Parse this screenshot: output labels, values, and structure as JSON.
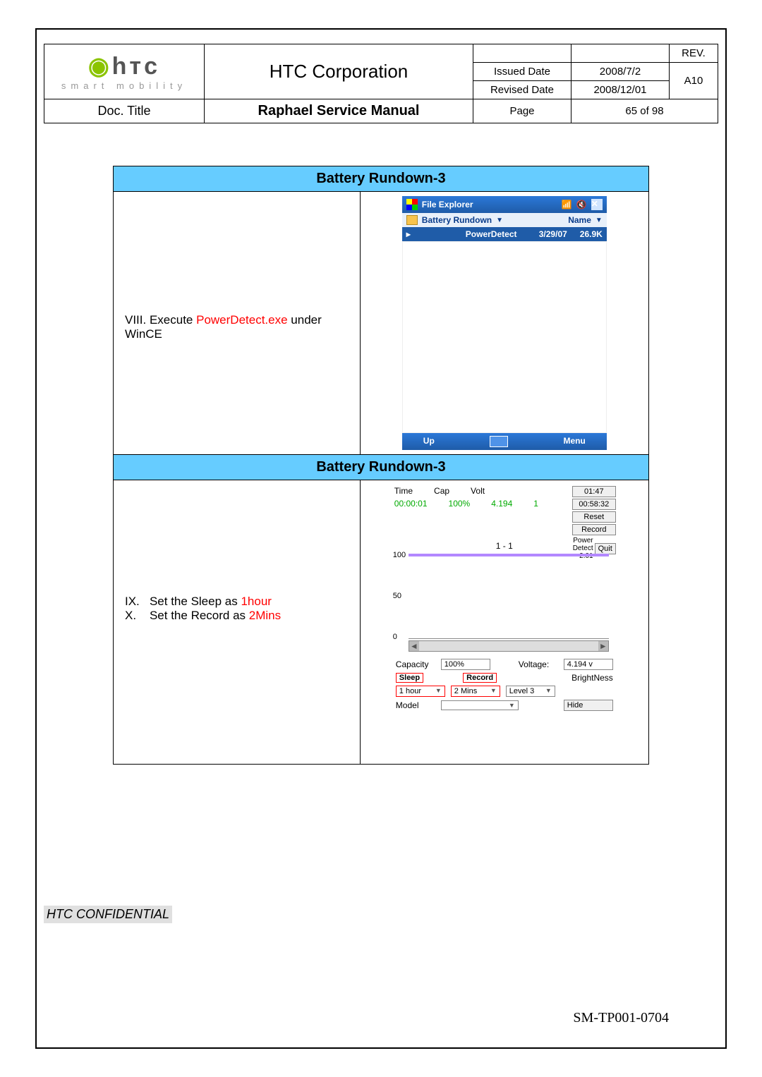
{
  "header": {
    "corp": "HTC Corporation",
    "tagline": "smart mobility",
    "rev_label": "REV.",
    "rev_value": "A10",
    "issued_label": "Issued Date",
    "issued_value": "2008/7/2",
    "revised_label": "Revised Date",
    "revised_value": "2008/12/01",
    "doc_label": "Doc. Title",
    "doc_title": "Raphael Service Manual",
    "page_label": "Page",
    "page_value": "65 of 98"
  },
  "section1": {
    "title": "Battery Rundown-3",
    "instr_num": "VIII.",
    "instr_pre": " Execute ",
    "instr_red": "PowerDetect.exe",
    "instr_post": " under WinCE",
    "fe": {
      "title": "File Explorer",
      "location": "Battery Rundown",
      "sort": "Name",
      "file": "PowerDetect",
      "date": "3/29/07",
      "size": "26.9K",
      "up": "Up",
      "menu": "Menu"
    }
  },
  "section2": {
    "title": "Battery Rundown-3",
    "ix": {
      "num": "IX.",
      "pre": "Set the Sleep as ",
      "red": "1hour"
    },
    "x": {
      "num": "X.",
      "pre": "Set the Record as ",
      "red": "2Mins"
    },
    "pd": {
      "cols": {
        "time": "Time",
        "cap": "Cap",
        "volt": "Volt"
      },
      "vals": {
        "time": "00:00:01",
        "cap": "100%",
        "volt": "4.194",
        "n": "1"
      },
      "side": [
        "01:47",
        "00:58:32",
        "Reset",
        "Record",
        "Quit"
      ],
      "ver": "Power Detect 2.01",
      "gtitle": "1 - 1",
      "y100": "100",
      "y50": "50",
      "y0": "0",
      "cap_label": "Capacity",
      "cap_val": "100%",
      "volt_label": "Voltage:",
      "volt_val": "4.194 v",
      "sleep": "Sleep",
      "sleep_v": "1 hour",
      "record": "Record",
      "record_v": "2 Mins",
      "bright": "BrightNess",
      "bright_v": "Level 3",
      "model": "Model",
      "model_v": "",
      "hide": "Hide"
    }
  },
  "footer": {
    "confid": "HTC CONFIDENTIAL",
    "docno": "SM-TP001-0704"
  }
}
